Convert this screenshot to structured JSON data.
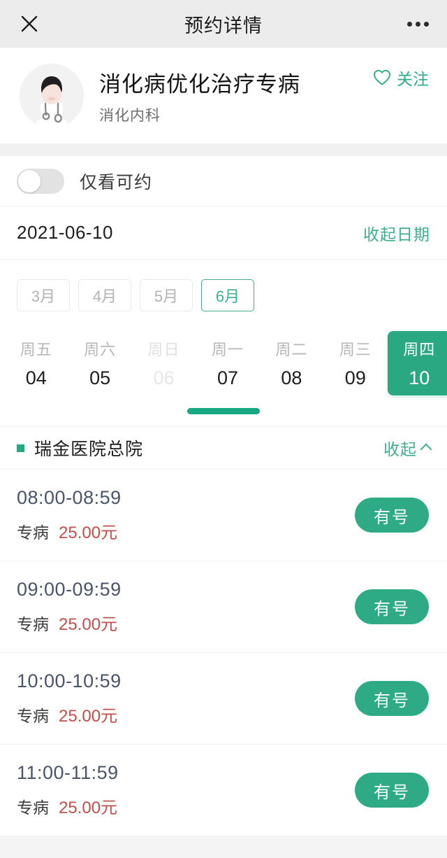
{
  "header": {
    "title": "预约详情",
    "close_icon": "close-icon",
    "more_icon": "more-dots-icon"
  },
  "doctor": {
    "name": "消化病优化治疗专病",
    "department": "消化内科",
    "avatar_icon": "doctor-avatar-icon",
    "follow_label": "关注",
    "follow_icon": "heart-outline-icon",
    "accent_color": "#2fab85"
  },
  "filter": {
    "toggle_label": "仅看可约",
    "toggle_on": false
  },
  "date_bar": {
    "selected_date": "2021-06-10",
    "collapse_label": "收起日期"
  },
  "calendar": {
    "months": [
      {
        "label": "3月",
        "active": false
      },
      {
        "label": "4月",
        "active": false
      },
      {
        "label": "5月",
        "active": false
      },
      {
        "label": "6月",
        "active": true
      }
    ],
    "days": [
      {
        "weekday": "周五",
        "day": "04",
        "state": "normal"
      },
      {
        "weekday": "周六",
        "day": "05",
        "state": "normal"
      },
      {
        "weekday": "周日",
        "day": "06",
        "state": "disabled"
      },
      {
        "weekday": "周一",
        "day": "07",
        "state": "normal"
      },
      {
        "weekday": "周二",
        "day": "08",
        "state": "normal"
      },
      {
        "weekday": "周三",
        "day": "09",
        "state": "normal"
      },
      {
        "weekday": "周四",
        "day": "10",
        "state": "selected"
      }
    ]
  },
  "hospital": {
    "name": "瑞金医院总院",
    "collapse_label": "收起",
    "chevron_icon": "chevron-up-icon",
    "bullet_color": "#2aa881"
  },
  "slots": [
    {
      "time": "08:00-08:59",
      "type": "专病",
      "price": "25.00元",
      "status": "有号"
    },
    {
      "time": "09:00-09:59",
      "type": "专病",
      "price": "25.00元",
      "status": "有号"
    },
    {
      "time": "10:00-10:59",
      "type": "专病",
      "price": "25.00元",
      "status": "有号"
    },
    {
      "time": "11:00-11:59",
      "type": "专病",
      "price": "25.00元",
      "status": "有号"
    }
  ],
  "colors": {
    "green": "#2aa881",
    "green_text": "#3fae8c",
    "price_red": "#c0504d",
    "time_blue": "#4a5568",
    "nav_bg": "#ececec"
  }
}
